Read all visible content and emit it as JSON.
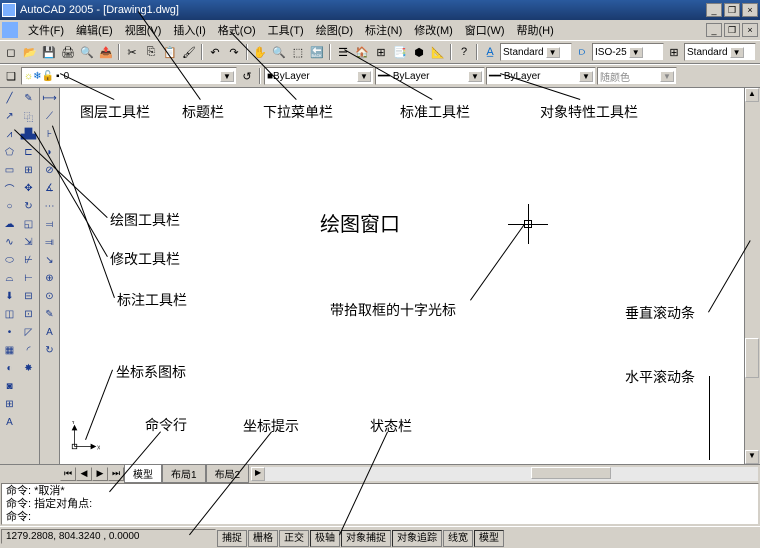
{
  "title": "AutoCAD 2005 - [Drawing1.dwg]",
  "menus": [
    "文件(F)",
    "编辑(E)",
    "视图(V)",
    "插入(I)",
    "格式(O)",
    "工具(T)",
    "绘图(D)",
    "标注(N)",
    "修改(M)",
    "窗口(W)",
    "帮助(H)"
  ],
  "styles": {
    "text": "Standard",
    "dim": "ISO-25",
    "table": "Standard"
  },
  "layer": {
    "current": "0",
    "icons": "☼❄☀🔒▪"
  },
  "properties": {
    "color": "■ByLayer",
    "linetype": "━━ ByLayer",
    "lineweight": "━━ ByLayer",
    "plotstyle": "随颜色"
  },
  "tabs": [
    "模型",
    "布局1",
    "布局2"
  ],
  "commandline": {
    "line1": "命令: *取消*",
    "line2": "命令: 指定对角点:",
    "line3": "命令:"
  },
  "coords": "1279.2808, 804.3240 , 0.0000",
  "status_buttons": [
    "捕捉",
    "栅格",
    "正交",
    "极轴",
    "对象捕捉",
    "对象追踪",
    "线宽",
    "模型"
  ],
  "drawing_label": "绘图窗口",
  "annotations": {
    "layer_tb": "图层工具栏",
    "title_tb": "标题栏",
    "menu_tb": "下拉菜单栏",
    "std_tb": "标准工具栏",
    "prop_tb": "对象特性工具栏",
    "draw_tb": "绘图工具栏",
    "mod_tb": "修改工具栏",
    "dim_tb": "标注工具栏",
    "crosshair": "带拾取框的十字光标",
    "vscroll": "垂直滚动条",
    "ucs": "坐标系图标",
    "hscroll": "水平滚动条",
    "cmdln": "命令行",
    "coord": "坐标提示",
    "status": "状态栏"
  }
}
